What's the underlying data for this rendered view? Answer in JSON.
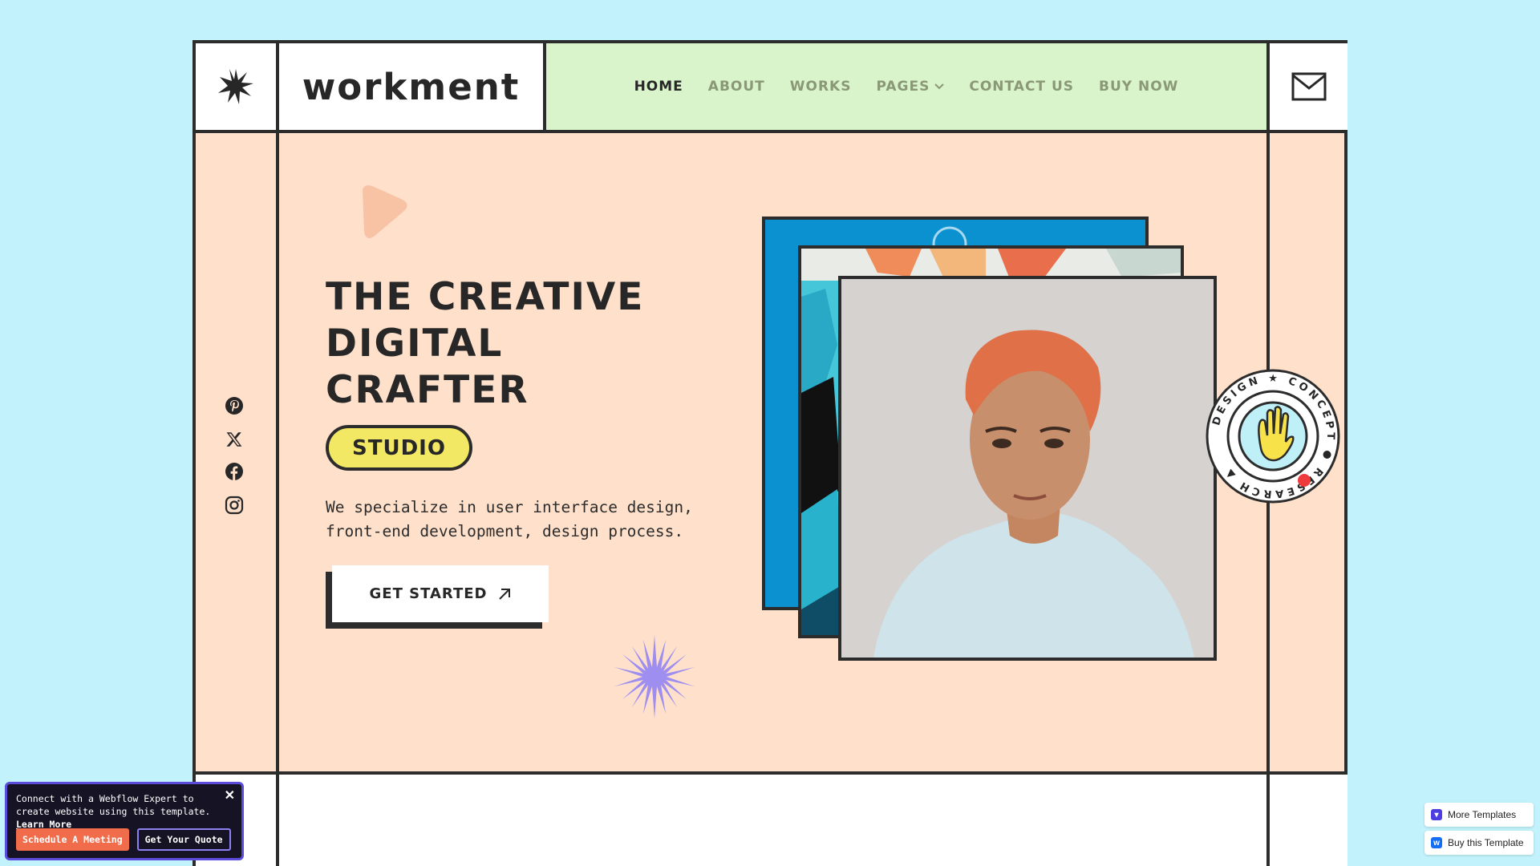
{
  "brand": {
    "name": "workment"
  },
  "nav": {
    "items": [
      {
        "label": "HOME",
        "active": true
      },
      {
        "label": "ABOUT",
        "active": false
      },
      {
        "label": "WORKS",
        "active": false
      },
      {
        "label": "PAGES",
        "active": false,
        "has_dropdown": true
      },
      {
        "label": "CONTACT US",
        "active": false
      },
      {
        "label": "BUY NOW",
        "active": false
      }
    ]
  },
  "hero": {
    "headline": [
      "THE CREATIVE",
      "DIGITAL",
      "CRAFTER"
    ],
    "tag": "STUDIO",
    "description_lines": [
      "We specialize in user interface design,",
      "front-end development, design process."
    ],
    "cta_label": "GET STARTED"
  },
  "badge": {
    "ring_text": "DESIGN ★ CONCEPT ● RESEARCH ▲"
  },
  "social": [
    "pinterest-icon",
    "x-icon",
    "facebook-icon",
    "instagram-icon"
  ],
  "popup": {
    "text": "Connect with a Webflow Expert to create website using this template.",
    "link": "Learn More",
    "btn_primary": "Schedule A Meeting",
    "btn_secondary": "Get Your Quote",
    "close": "✕"
  },
  "webflow": {
    "more_templates": "More Templates",
    "buy_template": "Buy this Template"
  },
  "colors": {
    "background": "#c2f2fb",
    "hero_bg": "#ffe0cb",
    "nav_bg": "#d9f4ca",
    "studio_tag": "#f2e863",
    "accent_purple": "#8c80f2",
    "accent_orange": "#f16c4b"
  }
}
